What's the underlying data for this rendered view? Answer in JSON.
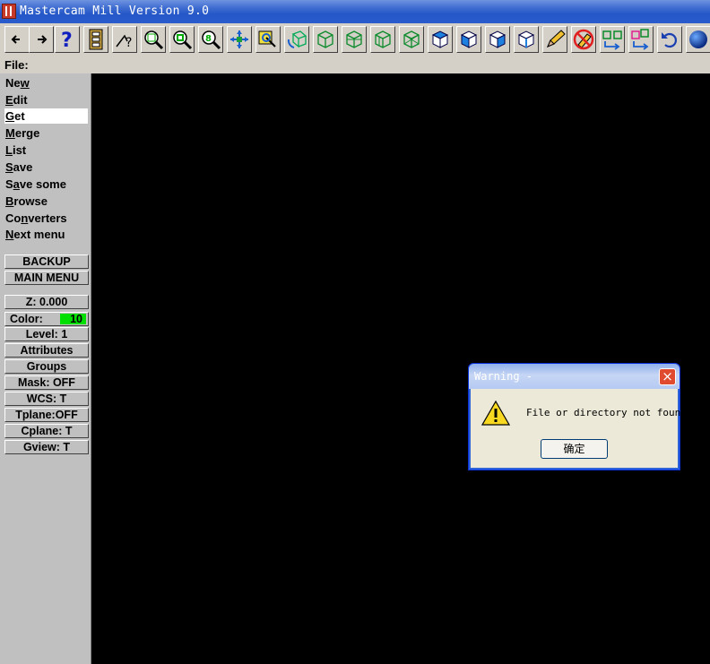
{
  "window": {
    "title": "Mastercam Mill Version 9.0"
  },
  "toolbar": {
    "buttons": [
      {
        "name": "back-arrow-icon"
      },
      {
        "name": "forward-arrow-icon"
      },
      {
        "name": "help-icon"
      },
      {
        "name": "file-cabinet-icon"
      },
      {
        "name": "analyze-icon"
      },
      {
        "name": "zoom-window-icon"
      },
      {
        "name": "zoom-out-icon"
      },
      {
        "name": "zoom-scale-icon"
      },
      {
        "name": "pan-icon"
      },
      {
        "name": "select-icon"
      },
      {
        "name": "rotate-icon"
      },
      {
        "name": "wireframe-top-icon"
      },
      {
        "name": "wireframe-front-icon"
      },
      {
        "name": "wireframe-side-icon"
      },
      {
        "name": "wireframe-iso-icon"
      },
      {
        "name": "cube-top-icon"
      },
      {
        "name": "cube-front-icon"
      },
      {
        "name": "cube-side-icon"
      },
      {
        "name": "cube-iso-icon"
      },
      {
        "name": "pencil-icon"
      },
      {
        "name": "no-delete-icon"
      },
      {
        "name": "transform-icon"
      },
      {
        "name": "group-icon"
      },
      {
        "name": "undo-icon"
      },
      {
        "name": "shade-sphere-icon"
      }
    ]
  },
  "menu": {
    "header": "File:",
    "items": [
      {
        "label": "New",
        "u": 2,
        "active": false
      },
      {
        "label": "Edit",
        "u": 0,
        "active": false
      },
      {
        "label": "Get",
        "u": 0,
        "active": true
      },
      {
        "label": "Merge",
        "u": 0,
        "active": false
      },
      {
        "label": "List",
        "u": 0,
        "active": false
      },
      {
        "label": "Save",
        "u": 0,
        "active": false
      },
      {
        "label": "Save some",
        "u": 1,
        "active": false
      },
      {
        "label": "Browse",
        "u": 0,
        "active": false
      },
      {
        "label": "Converters",
        "u": 2,
        "active": false
      },
      {
        "label": "Next menu",
        "u": 0,
        "active": false
      }
    ]
  },
  "nav": {
    "backup": "BACKUP",
    "main_menu": "MAIN MENU"
  },
  "status": {
    "z": "Z:   0.000",
    "color_label": "Color:",
    "color_value": "10",
    "level": "Level:  1",
    "attributes": "Attributes",
    "groups": "Groups",
    "mask": "Mask:  OFF",
    "wcs": "WCS:   T",
    "tplane": "Tplane:OFF",
    "cplane": "Cplane:  T",
    "gview": "Gview:   T"
  },
  "dialog": {
    "title": "Warning -",
    "message": "File or directory not found",
    "ok_label": "确定"
  },
  "colors": {
    "title_bar": "#2557c8",
    "panel": "#c0c0c0",
    "color_swatch": "#00e000",
    "canvas": "#000000"
  }
}
